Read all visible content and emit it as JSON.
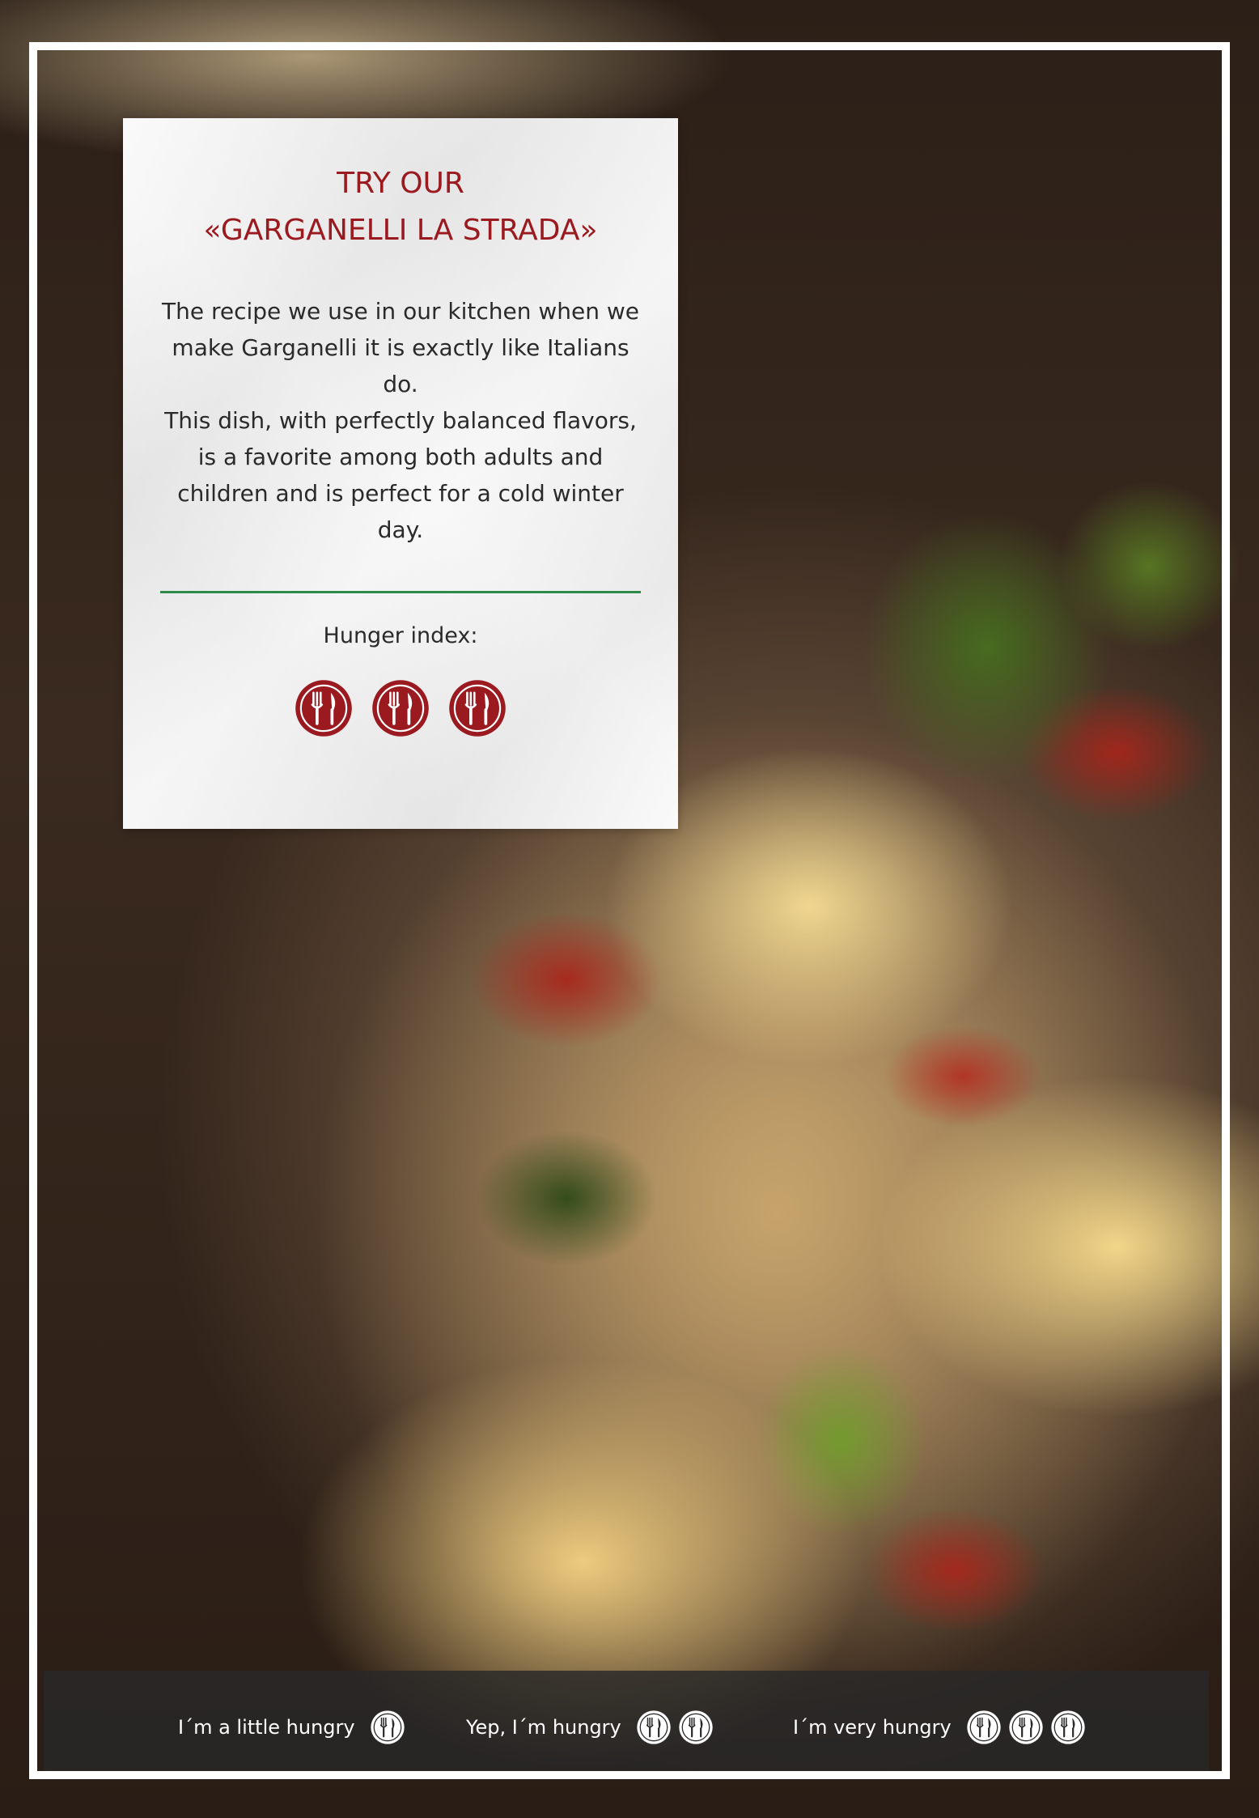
{
  "promo": {
    "title_line1": "TRY OUR",
    "title_line2": "«GARGANELLI LA STRADA»",
    "description_1": "The recipe we use in our kitchen when we make Garganelli it is exactly like Italians do.",
    "description_2": "This dish, with perfectly balanced flavors, is a favorite among both adults and children and is perfect for a cold winter day.",
    "hunger_label": "Hunger index:",
    "hunger_level": 3,
    "hunger_max": 3
  },
  "legend": [
    {
      "label": "I´m a little hungry",
      "icons": 1
    },
    {
      "label": "Yep, I´m hungry",
      "icons": 2
    },
    {
      "label": "I´m very hungry",
      "icons": 3
    }
  ],
  "colors": {
    "accent_red": "#9a1a20",
    "divider_green": "#2e8a4a",
    "legend_bar": "#282828"
  },
  "icons": {
    "hunger": "fork-knife-circle-icon"
  }
}
